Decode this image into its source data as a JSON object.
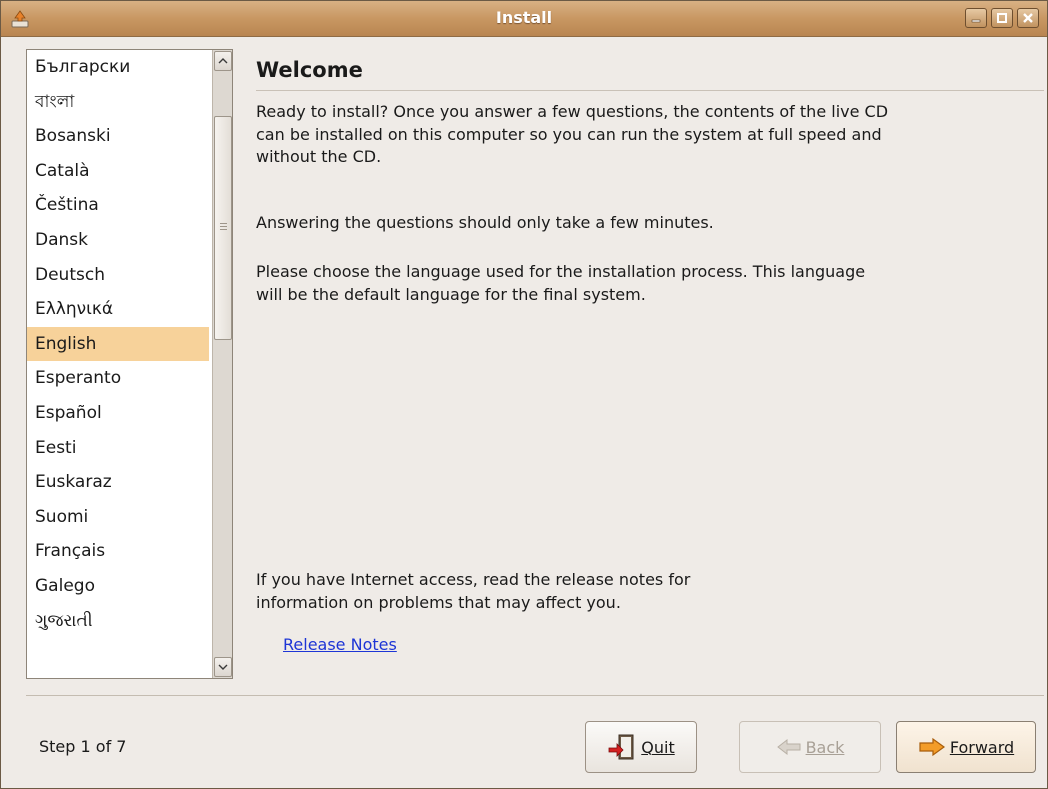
{
  "window": {
    "title": "Install",
    "icons": {
      "app": "installer-icon",
      "minimize": "minimize-icon",
      "maximize": "maximize-icon",
      "close": "close-icon"
    }
  },
  "languages": {
    "items": [
      "Български",
      "বাংলা",
      "Bosanski",
      "Català",
      "Čeština",
      "Dansk",
      "Deutsch",
      "Ελληνικά",
      "English",
      "Esperanto",
      "Español",
      "Eesti",
      "Euskaraz",
      "Suomi",
      "Français",
      "Galego",
      "ગુજરાતી"
    ],
    "selected": "English",
    "selected_color": "#f7d29a"
  },
  "content": {
    "heading": "Welcome",
    "paragraph1": "Ready to install? Once you answer a few questions, the contents of the live CD can be installed on this computer so you can run the system at full speed and without the CD.",
    "paragraph2": "Answering the questions should only take a few minutes.",
    "paragraph3": "Please choose the language used for the installation process. This language will be the default language for the final system.",
    "paragraph4": "If you have Internet access, read the release notes for information on problems that may affect you.",
    "release_notes_link": "Release Notes"
  },
  "footer": {
    "step": "Step 1 of 7",
    "buttons": {
      "quit": {
        "label": "Quit",
        "icon": "quit-door-icon"
      },
      "back": {
        "label": "Back",
        "icon": "back-arrow-icon",
        "enabled": false
      },
      "forward": {
        "label": "Forward",
        "icon": "forward-arrow-icon"
      }
    }
  },
  "colors": {
    "titlebar": "#c89762",
    "link": "#1d35d6",
    "window_bg": "#efebe7"
  }
}
